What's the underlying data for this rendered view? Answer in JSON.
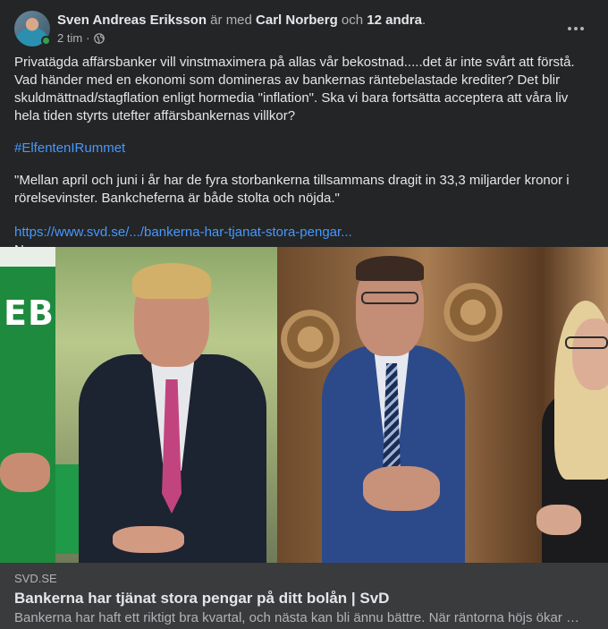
{
  "post": {
    "author": "Sven Andreas Eriksson",
    "with_text": " är med ",
    "tagged_person": "Carl Norberg",
    "and_text": " och ",
    "others": "12 andra",
    "period": ".",
    "time": "2 tim",
    "separator": "·",
    "audience_icon": "globe-icon",
    "more_icon": "more-options-icon",
    "body": "Privatägda affärsbanker vill vinstmaximera på allas vår bekostnad.....det är inte svårt att förstå. Vad händer med en ekonomi som domineras av bankernas räntebelastade krediter? Det blir skuldmättnad/stagflation enligt hormedia \"inflation\". Ska vi bara fortsätta acceptera att våra liv hela tiden styrts utefter affärsbankernas villkor?",
    "hashtag": "#ElfentenIRummet",
    "quote": "\"Mellan april och juni i år har de fyra storbankerna tillsammans dragit in 33,3 miljarder kronor i rörelsevinster. Bankcheferna är både stolta och nöjda.\"",
    "link": "https://www.svd.se/.../bankerna-har-tjanat-stora-pengar...",
    "trailing": "N"
  },
  "image": {
    "sign_text": "EB"
  },
  "preview": {
    "domain": "SVD.SE",
    "title": "Bankerna har tjänat stora pengar på ditt bolån | SvD",
    "description": "Bankerna har haft ett riktigt bra kvartal, och nästa kan bli ännu bättre. När räntorna höjs ökar …"
  },
  "colors": {
    "background": "#242526",
    "link": "#4599ff",
    "preview_bg": "#3a3b3c",
    "online": "#31a24c"
  }
}
